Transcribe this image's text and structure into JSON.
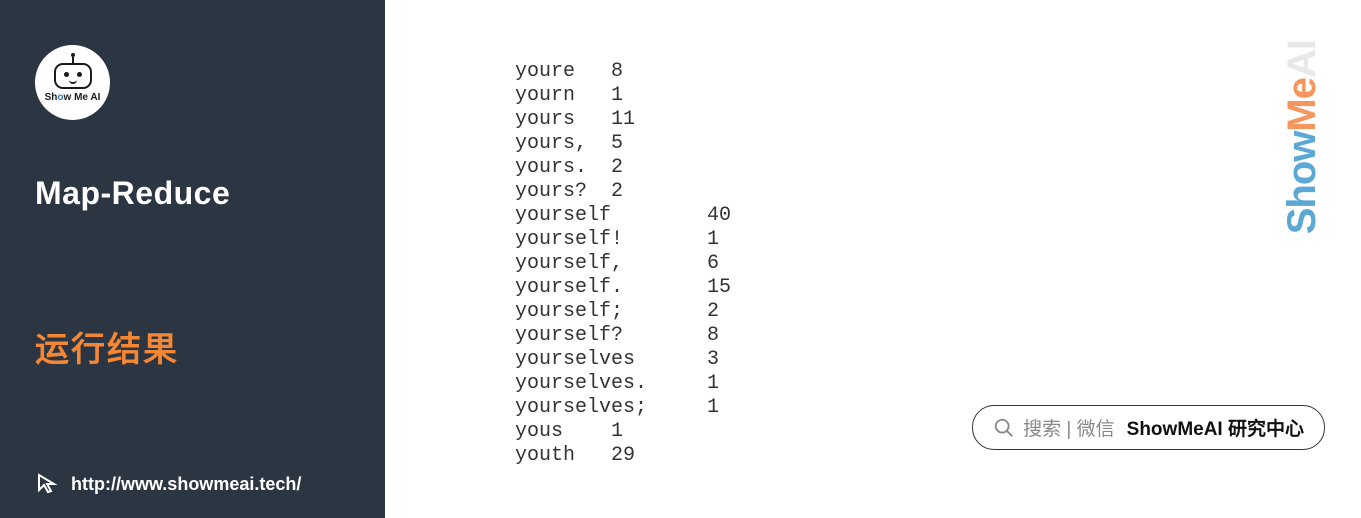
{
  "sidebar": {
    "logo_text_before": "Sh",
    "logo_text_o": "o",
    "logo_text_after": "w Me AI",
    "title": "Map-Reduce",
    "subtitle": "运行结果",
    "url": "http://www.showmeai.tech/"
  },
  "output_rows": [
    {
      "word": "youre",
      "count": 8,
      "tab": 1
    },
    {
      "word": "yourn",
      "count": 1,
      "tab": 1
    },
    {
      "word": "yours",
      "count": 11,
      "tab": 1
    },
    {
      "word": "yours,",
      "count": 5,
      "tab": 1
    },
    {
      "word": "yours.",
      "count": 2,
      "tab": 1
    },
    {
      "word": "yours?",
      "count": 2,
      "tab": 1
    },
    {
      "word": "yourself",
      "count": 40,
      "tab": 2
    },
    {
      "word": "yourself!",
      "count": 1,
      "tab": 2
    },
    {
      "word": "yourself,",
      "count": 6,
      "tab": 2
    },
    {
      "word": "yourself.",
      "count": 15,
      "tab": 2
    },
    {
      "word": "yourself;",
      "count": 2,
      "tab": 2
    },
    {
      "word": "yourself?",
      "count": 8,
      "tab": 2
    },
    {
      "word": "yourselves",
      "count": 3,
      "tab": 2
    },
    {
      "word": "yourselves.",
      "count": 1,
      "tab": 2
    },
    {
      "word": "yourselves;",
      "count": 1,
      "tab": 2
    },
    {
      "word": "yous",
      "count": 1,
      "tab": 1
    },
    {
      "word": "youth",
      "count": 29,
      "tab": 1
    }
  ],
  "watermark": {
    "part1": "Show",
    "part2": "Me",
    "part3": "AI"
  },
  "search": {
    "label": "搜索 | 微信",
    "brand": "ShowMeAI 研究中心"
  }
}
